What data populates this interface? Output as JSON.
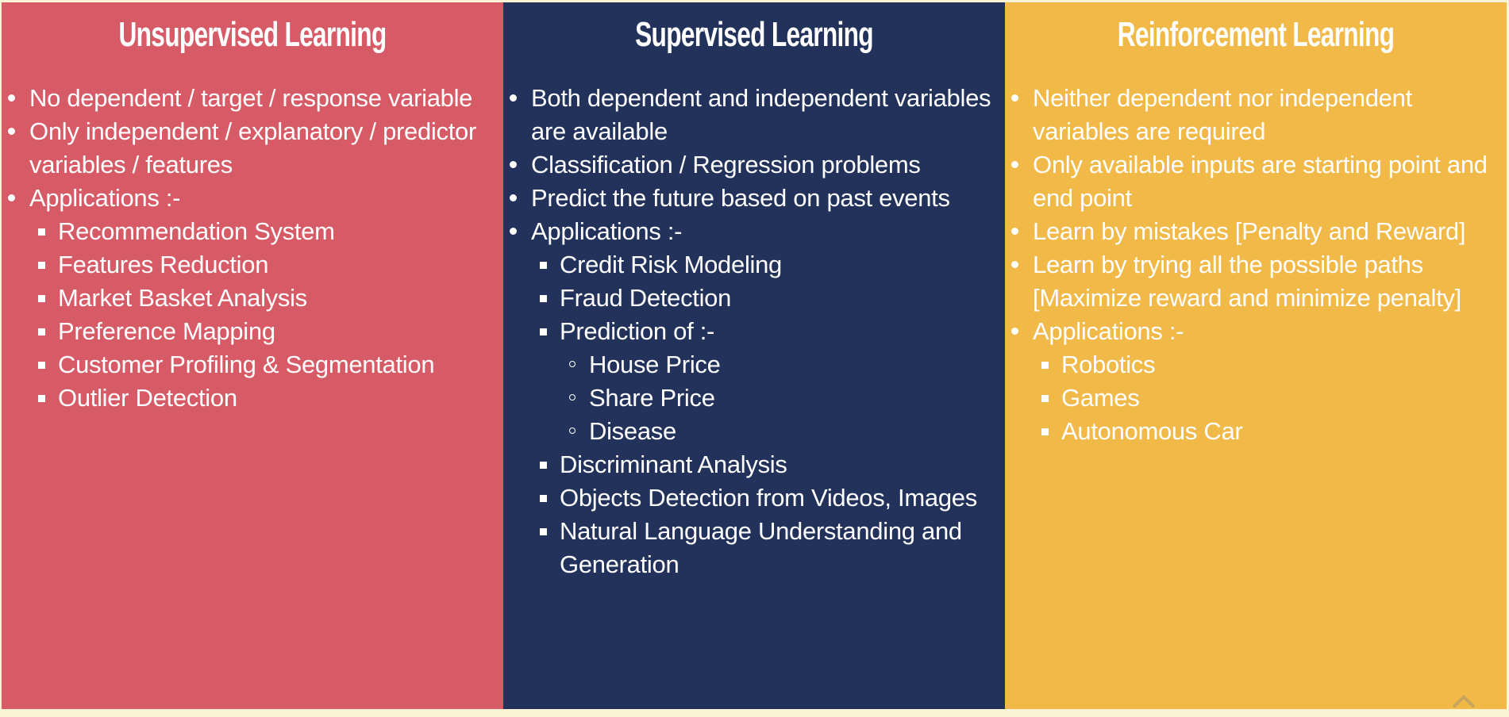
{
  "colors": {
    "background": "#fbf3d6",
    "unsupervised": "#d75b66",
    "supervised": "#22325a",
    "reinforcement": "#f0b948",
    "text": "#ffffff"
  },
  "columns": [
    {
      "title": "Unsupervised Learning",
      "items": [
        {
          "text": "No dependent / target / response variable"
        },
        {
          "text": "Only independent / explanatory / predictor variables / features"
        },
        {
          "text": "Applications :-"
        }
      ],
      "applications": [
        {
          "text": "Recommendation System"
        },
        {
          "text": "Features Reduction"
        },
        {
          "text": "Market Basket Analysis"
        },
        {
          "text": "Preference Mapping"
        },
        {
          "text": "Customer Profiling & Segmentation"
        },
        {
          "text": "Outlier Detection"
        }
      ]
    },
    {
      "title": "Supervised Learning",
      "items": [
        {
          "text": "Both dependent and independent variables are available"
        },
        {
          "text": "Classification / Regression problems"
        },
        {
          "text": "Predict the future based on past events"
        },
        {
          "text": "Applications :-"
        }
      ],
      "applications": [
        {
          "text": "Credit Risk Modeling"
        },
        {
          "text": "Fraud Detection"
        },
        {
          "text": "Prediction of :-"
        },
        {
          "text": "Discriminant Analysis"
        },
        {
          "text": "Objects Detection from Videos, Images"
        },
        {
          "text": "Natural Language Understanding and Generation"
        }
      ],
      "prediction_of": [
        {
          "text": "House Price"
        },
        {
          "text": "Share Price"
        },
        {
          "text": "Disease"
        }
      ]
    },
    {
      "title": "Reinforcement Learning",
      "items": [
        {
          "text": "Neither dependent nor independent variables are required"
        },
        {
          "text": "Only available inputs are starting point and end point"
        },
        {
          "text": "Learn by mistakes [Penalty and Reward]"
        },
        {
          "text": "Learn by trying all the possible paths [Maximize reward and minimize penalty]"
        },
        {
          "text": "Applications :-"
        }
      ],
      "applications": [
        {
          "text": "Robotics"
        },
        {
          "text": "Games"
        },
        {
          "text": "Autonomous Car"
        }
      ]
    }
  ],
  "icons": {
    "scroll_up": "chevron-up-icon"
  }
}
